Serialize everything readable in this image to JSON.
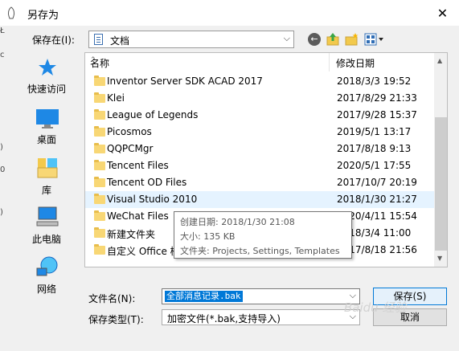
{
  "window": {
    "title": "另存为",
    "close_glyph": "✕"
  },
  "left_strip": [
    "Ł",
    "c",
    ")",
    "0",
    ")"
  ],
  "toolbar": {
    "save_in_label": "保存在(I):",
    "location": "文档",
    "back_glyph": "←"
  },
  "places": [
    {
      "label": "快速访问",
      "icon": "star-icon"
    },
    {
      "label": "桌面",
      "icon": "desktop-icon"
    },
    {
      "label": "库",
      "icon": "library-icon"
    },
    {
      "label": "此电脑",
      "icon": "computer-icon"
    },
    {
      "label": "网络",
      "icon": "network-icon"
    }
  ],
  "list": {
    "col_name": "名称",
    "col_date": "修改日期",
    "rows": [
      {
        "name": "Inventor Server SDK ACAD 2017",
        "date": "2018/3/3 19:52"
      },
      {
        "name": "Klei",
        "date": "2017/8/29 21:33"
      },
      {
        "name": "League of Legends",
        "date": "2017/9/28 15:37"
      },
      {
        "name": "Picosmos",
        "date": "2019/5/1 13:17"
      },
      {
        "name": "QQPCMgr",
        "date": "2017/8/18 9:13"
      },
      {
        "name": "Tencent Files",
        "date": "2020/5/1 17:55"
      },
      {
        "name": "Tencent OD Files",
        "date": "2017/10/7 20:19"
      },
      {
        "name": "Visual Studio 2010",
        "date": "2018/1/30 21:27",
        "selected": true
      },
      {
        "name": "WeChat Files",
        "date": "2020/4/11 15:54"
      },
      {
        "name": "新建文件夹",
        "date": "2018/3/4 11:00"
      },
      {
        "name": "自定义 Office 模板",
        "date": "2017/8/18 21:56"
      }
    ]
  },
  "tooltip": {
    "created": "创建日期: 2018/1/30 21:08",
    "size": "大小: 135 KB",
    "folders": "文件夹: Projects, Settings, Templates"
  },
  "form": {
    "filename_label": "文件名(N):",
    "filename_value": "全部消息记录.bak",
    "filetype_label": "保存类型(T):",
    "filetype_value": "加密文件(*.bak,支持导入)",
    "save_button": "保存(S)",
    "cancel_button": "取消"
  },
  "watermark": "Baidu 经验",
  "colors": {
    "accent": "#0078d7",
    "folder": "#f8d775",
    "selected_row": "#e5f3ff"
  }
}
